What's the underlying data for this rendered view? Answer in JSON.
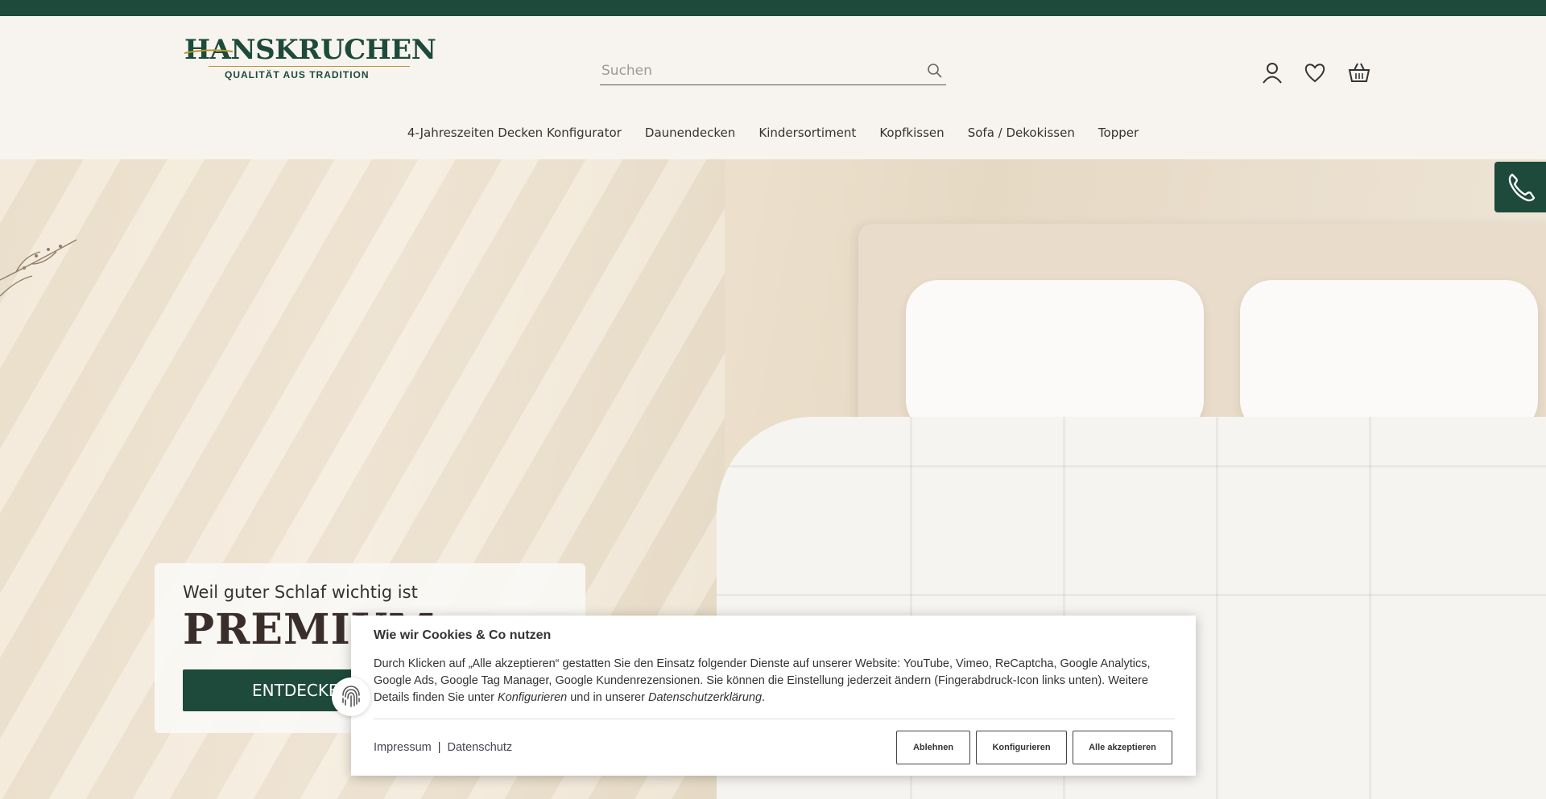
{
  "logo": {
    "name": "HANSKRUCHEN",
    "tagline": "QUALITÄT AUS TRADITION"
  },
  "search": {
    "placeholder": "Suchen"
  },
  "header_icons": [
    "user-icon",
    "heart-icon",
    "basket-icon"
  ],
  "nav": {
    "items": [
      {
        "label": "4-Jahreszeiten Decken Konfigurator"
      },
      {
        "label": "Daunendecken"
      },
      {
        "label": "Kindersortiment"
      },
      {
        "label": "Kopfkissen"
      },
      {
        "label": "Sofa / Dekokissen"
      },
      {
        "label": "Topper"
      }
    ]
  },
  "hero": {
    "subtitle": "Weil guter Schlaf wichtig ist",
    "title": "PREMIUM",
    "cta": "ENTDECKEN"
  },
  "cookie": {
    "title": "Wie wir Cookies & Co nutzen",
    "text_before": "Durch Klicken auf „Alle akzeptieren“ gestatten Sie den Einsatz folgender Dienste auf unserer Website: YouTube, Vimeo, ReCaptcha, Google Analytics, Google Ads, Google Tag Manager, Google Kundenrezensionen. Sie können die Einstellung jederzeit ändern (Fingerabdruck-Icon links unten). Weitere Details finden Sie unter ",
    "text_link1": "Konfigurieren",
    "text_mid": " und in unserer ",
    "text_link2": "Datenschutzerklärung",
    "text_end": ".",
    "link_impressum": "Impressum",
    "separator": "|",
    "link_datenschutz": "Datenschutz",
    "btn_decline": "Ablehnen",
    "btn_configure": "Konfigurieren",
    "btn_accept": "Alle akzeptieren"
  },
  "colors": {
    "brand": "#1d4a3a",
    "background": "#f7f4ef",
    "gold": "#b8962e"
  }
}
